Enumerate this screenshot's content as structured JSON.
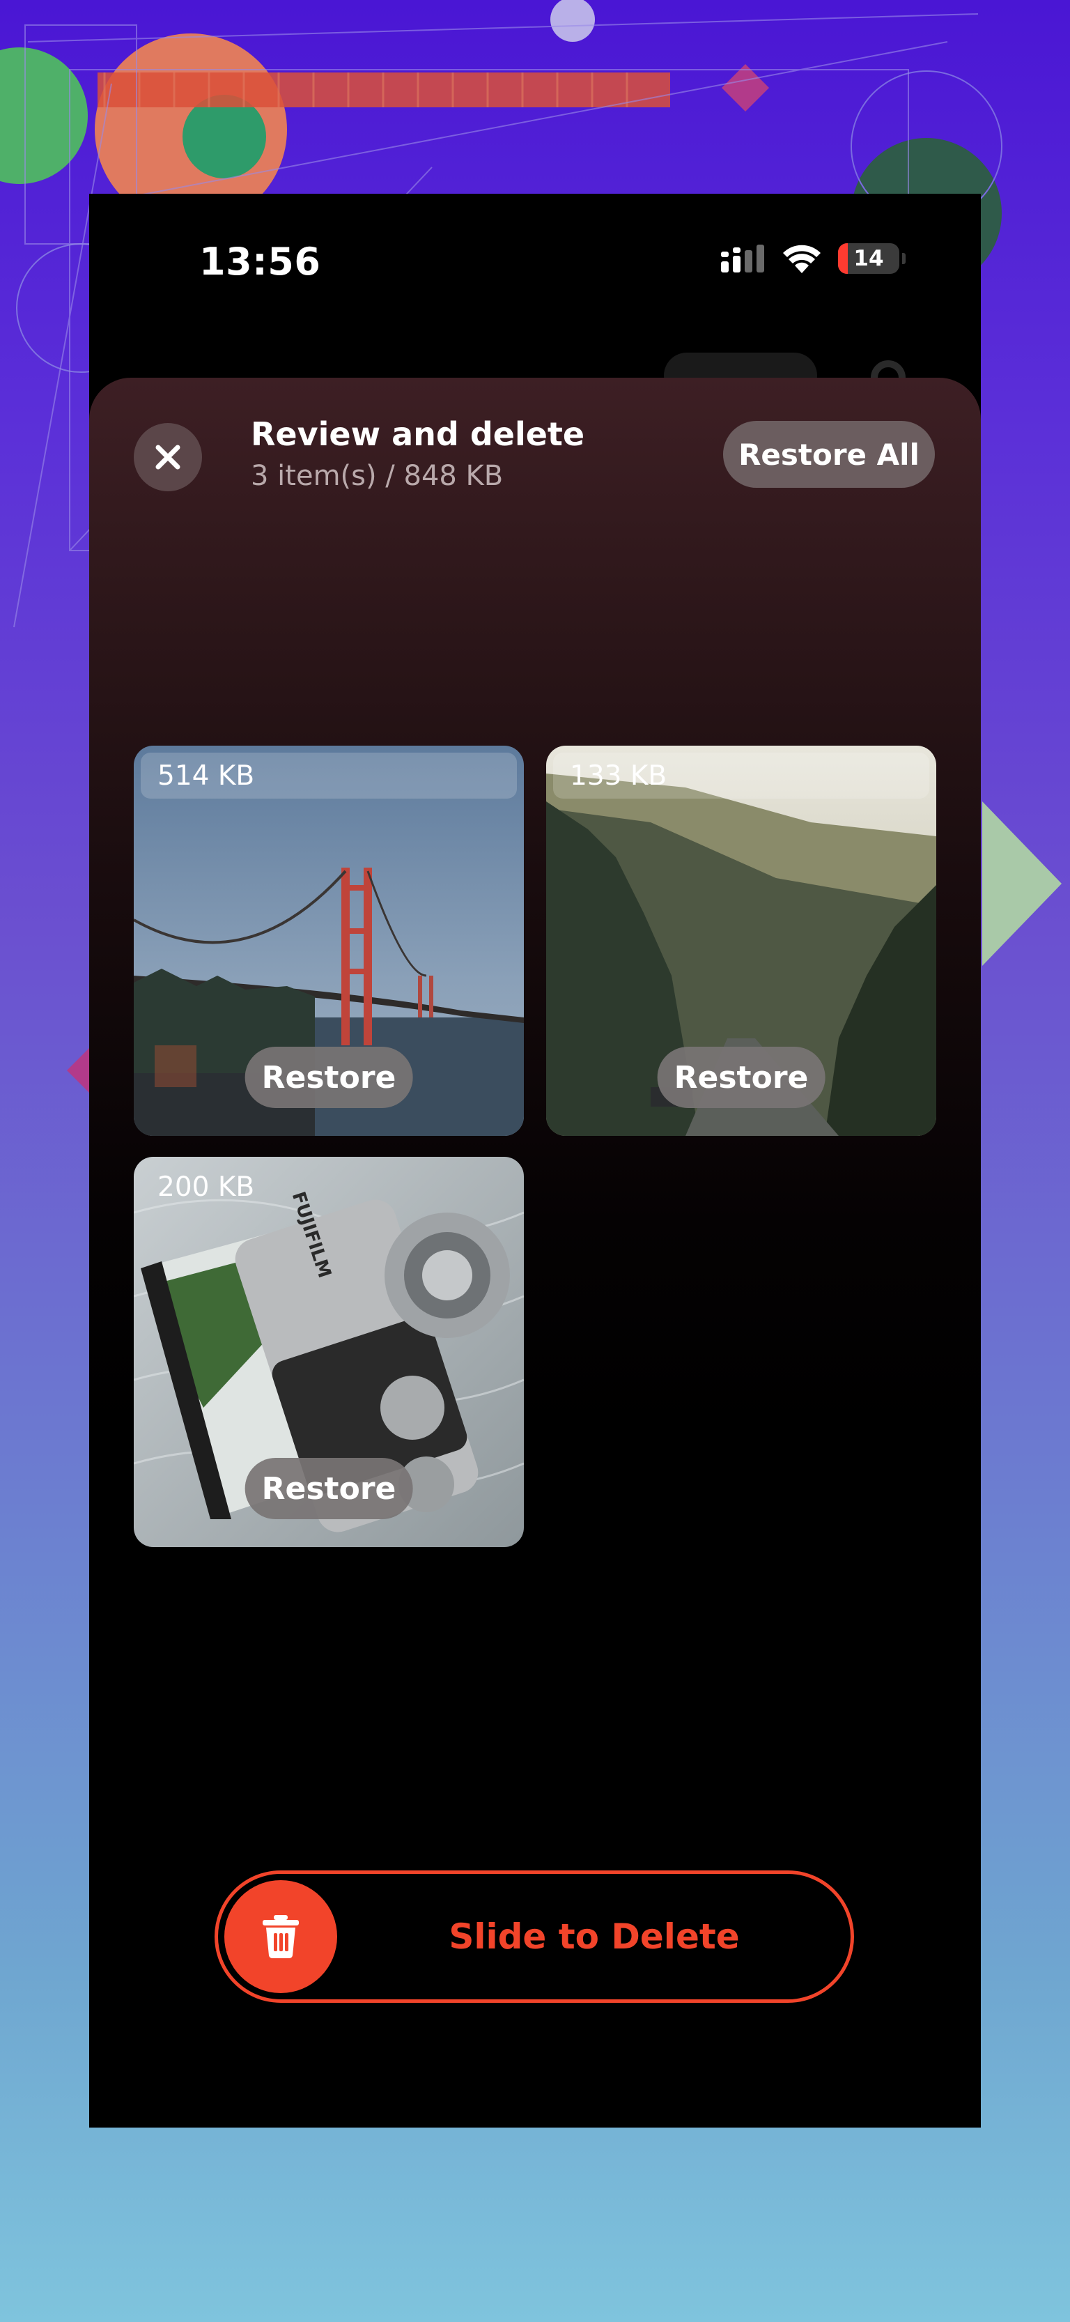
{
  "status_bar": {
    "time": "13:56",
    "battery": "14",
    "icons": [
      "cellular-signal-icon",
      "wifi-icon",
      "battery-icon"
    ]
  },
  "sheet": {
    "title": "Review and delete",
    "subtitle": "3 item(s) / 848 KB",
    "restore_all_label": "Restore All",
    "close_icon": "close-icon"
  },
  "photos": [
    {
      "size": "514 KB",
      "restore_label": "Restore",
      "subject": "golden-gate-bridge"
    },
    {
      "size": "133 KB",
      "restore_label": "Restore",
      "subject": "forest-road"
    },
    {
      "size": "200 KB",
      "restore_label": "Restore",
      "subject": "camera"
    }
  ],
  "slider": {
    "label": "Slide to Delete",
    "icon": "trash-icon"
  },
  "colors": {
    "accent": "#f2442a",
    "battery_low": "#ff3b30",
    "sheet_top": "#3d1f24"
  }
}
